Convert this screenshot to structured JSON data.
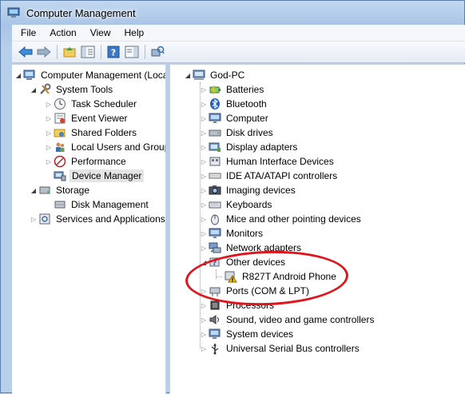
{
  "window": {
    "title": "Computer Management"
  },
  "menu": [
    "File",
    "Action",
    "View",
    "Help"
  ],
  "left_tree": [
    {
      "label": "Computer Management (Local",
      "icon": "computer-mgmt-icon",
      "level": 0,
      "arrow": "open"
    },
    {
      "label": "System Tools",
      "icon": "tools-icon",
      "level": 1,
      "arrow": "open"
    },
    {
      "label": "Task Scheduler",
      "icon": "clock-icon",
      "level": 2,
      "arrow": "closed"
    },
    {
      "label": "Event Viewer",
      "icon": "event-viewer-icon",
      "level": 2,
      "arrow": "closed"
    },
    {
      "label": "Shared Folders",
      "icon": "shared-folder-icon",
      "level": 2,
      "arrow": "closed"
    },
    {
      "label": "Local Users and Groups",
      "icon": "users-icon",
      "level": 2,
      "arrow": "closed"
    },
    {
      "label": "Performance",
      "icon": "performance-icon",
      "level": 2,
      "arrow": "closed"
    },
    {
      "label": "Device Manager",
      "icon": "device-manager-icon",
      "level": 2,
      "arrow": "none",
      "selected": true
    },
    {
      "label": "Storage",
      "icon": "storage-icon",
      "level": 1,
      "arrow": "open"
    },
    {
      "label": "Disk Management",
      "icon": "disk-icon",
      "level": 2,
      "arrow": "none"
    },
    {
      "label": "Services and Applications",
      "icon": "services-icon",
      "level": 1,
      "arrow": "closed"
    }
  ],
  "right_tree": [
    {
      "label": "God-PC",
      "icon": "computer-icon",
      "level": 0,
      "arrow": "open"
    },
    {
      "label": "Batteries",
      "icon": "battery-icon",
      "level": 1,
      "arrow": "closed"
    },
    {
      "label": "Bluetooth",
      "icon": "bluetooth-icon",
      "level": 1,
      "arrow": "closed"
    },
    {
      "label": "Computer",
      "icon": "monitor-icon",
      "level": 1,
      "arrow": "closed"
    },
    {
      "label": "Disk drives",
      "icon": "disk-drive-icon",
      "level": 1,
      "arrow": "closed"
    },
    {
      "label": "Display adapters",
      "icon": "display-adapter-icon",
      "level": 1,
      "arrow": "closed"
    },
    {
      "label": "Human Interface Devices",
      "icon": "hid-icon",
      "level": 1,
      "arrow": "closed"
    },
    {
      "label": "IDE ATA/ATAPI controllers",
      "icon": "ide-icon",
      "level": 1,
      "arrow": "closed"
    },
    {
      "label": "Imaging devices",
      "icon": "camera-icon",
      "level": 1,
      "arrow": "closed"
    },
    {
      "label": "Keyboards",
      "icon": "keyboard-icon",
      "level": 1,
      "arrow": "closed"
    },
    {
      "label": "Mice and other pointing devices",
      "icon": "mouse-icon",
      "level": 1,
      "arrow": "closed"
    },
    {
      "label": "Monitors",
      "icon": "monitor-icon",
      "level": 1,
      "arrow": "closed"
    },
    {
      "label": "Network adapters",
      "icon": "network-icon",
      "level": 1,
      "arrow": "closed"
    },
    {
      "label": "Other devices",
      "icon": "other-devices-icon",
      "level": 1,
      "arrow": "open"
    },
    {
      "label": "R827T Android Phone",
      "icon": "warning-device-icon",
      "level": 2,
      "arrow": "none"
    },
    {
      "label": "Ports (COM & LPT)",
      "icon": "port-icon",
      "level": 1,
      "arrow": "closed"
    },
    {
      "label": "Processors",
      "icon": "processor-icon",
      "level": 1,
      "arrow": "closed"
    },
    {
      "label": "Sound, video and game controllers",
      "icon": "sound-icon",
      "level": 1,
      "arrow": "closed"
    },
    {
      "label": "System devices",
      "icon": "system-devices-icon",
      "level": 1,
      "arrow": "closed"
    },
    {
      "label": "Universal Serial Bus controllers",
      "icon": "usb-icon",
      "level": 1,
      "arrow": "closed"
    }
  ],
  "colors": {
    "annotation": "#e0141c",
    "titlebar": "#c2d8f0"
  }
}
